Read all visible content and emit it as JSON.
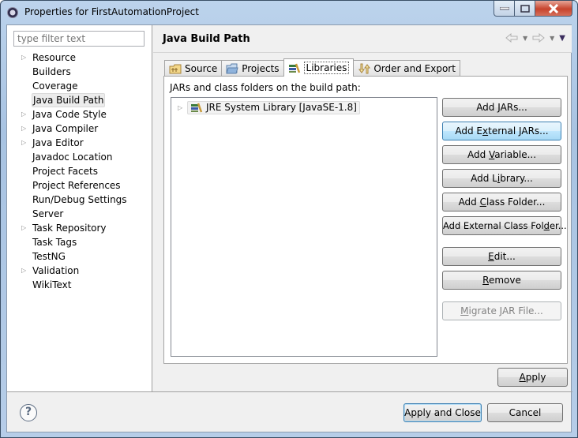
{
  "window": {
    "title": "Properties for FirstAutomationProject",
    "controls": [
      "minimize",
      "maximize",
      "close"
    ]
  },
  "sidebar": {
    "filter_placeholder": "type filter text",
    "items": [
      {
        "label": "Resource",
        "expandable": true
      },
      {
        "label": "Builders",
        "expandable": false
      },
      {
        "label": "Coverage",
        "expandable": false
      },
      {
        "label": "Java Build Path",
        "expandable": false,
        "selected": true
      },
      {
        "label": "Java Code Style",
        "expandable": true
      },
      {
        "label": "Java Compiler",
        "expandable": true
      },
      {
        "label": "Java Editor",
        "expandable": true
      },
      {
        "label": "Javadoc Location",
        "expandable": false
      },
      {
        "label": "Project Facets",
        "expandable": false
      },
      {
        "label": "Project References",
        "expandable": false
      },
      {
        "label": "Run/Debug Settings",
        "expandable": false
      },
      {
        "label": "Server",
        "expandable": false
      },
      {
        "label": "Task Repository",
        "expandable": true
      },
      {
        "label": "Task Tags",
        "expandable": false
      },
      {
        "label": "TestNG",
        "expandable": false
      },
      {
        "label": "Validation",
        "expandable": true
      },
      {
        "label": "WikiText",
        "expandable": false
      }
    ]
  },
  "page": {
    "title": "Java Build Path",
    "nav": {
      "back_icon": "arrow-left-icon",
      "forward_icon": "arrow-right-icon",
      "menu_icon": "view-menu-icon"
    },
    "tabs": [
      {
        "label": "Source",
        "icon": "source-folder-icon"
      },
      {
        "label": "Projects",
        "icon": "folder-icon"
      },
      {
        "label": "Libraries",
        "icon": "library-icon",
        "active": true
      },
      {
        "label": "Order and Export",
        "icon": "order-icon"
      }
    ],
    "libraries_label": "JARs and class folders on the build path:",
    "libraries": [
      {
        "label": "JRE System Library [JavaSE-1.8]",
        "icon": "library-icon"
      }
    ],
    "buttons": [
      {
        "label": "Add JARs...",
        "mnemonic": "J"
      },
      {
        "label": "Add External JARs...",
        "mnemonic": "x",
        "hover": true
      },
      {
        "label": "Add Variable...",
        "mnemonic": "V"
      },
      {
        "label": "Add Library...",
        "mnemonic": "i"
      },
      {
        "label": "Add Class Folder...",
        "mnemonic": "C"
      },
      {
        "label": "Add External Class Folder...",
        "mnemonic": "d"
      },
      {
        "label": "Edit...",
        "mnemonic": "E"
      },
      {
        "label": "Remove",
        "mnemonic": "R"
      },
      {
        "label": "Migrate JAR File...",
        "mnemonic": "M",
        "disabled": true
      }
    ],
    "apply_label": "Apply"
  },
  "footer": {
    "help_icon": "help-icon",
    "apply_close_label": "Apply and Close",
    "cancel_label": "Cancel"
  }
}
